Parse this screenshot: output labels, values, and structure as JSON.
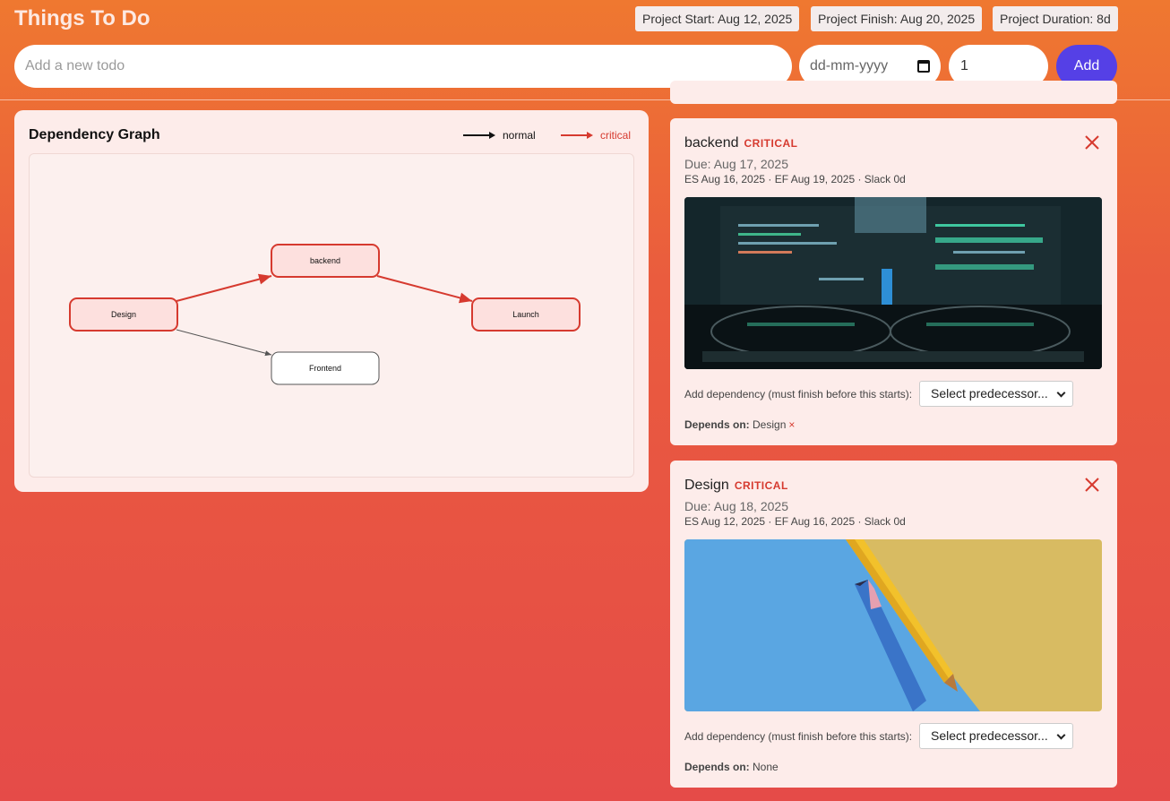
{
  "header": {
    "title": "Things To Do",
    "project_start": "Project Start: Aug 12, 2025",
    "project_finish": "Project Finish: Aug 20, 2025",
    "project_duration": "Project Duration: 8d"
  },
  "form": {
    "todo_placeholder": "Add a new todo",
    "date_placeholder": "dd-mm-yyyy",
    "duration_value": "1",
    "add_label": "Add"
  },
  "graph": {
    "title": "Dependency Graph",
    "legend_normal": "normal",
    "legend_critical": "critical",
    "nodes": [
      {
        "id": "design",
        "label": "Design",
        "critical": true
      },
      {
        "id": "backend",
        "label": "backend",
        "critical": true
      },
      {
        "id": "frontend",
        "label": "Frontend",
        "critical": false
      },
      {
        "id": "launch",
        "label": "Launch",
        "critical": true
      }
    ],
    "edges": [
      {
        "from": "design",
        "to": "backend",
        "critical": true
      },
      {
        "from": "backend",
        "to": "launch",
        "critical": true
      },
      {
        "from": "design",
        "to": "frontend",
        "critical": false
      }
    ]
  },
  "cards": [
    {
      "title": "backend",
      "badge": "CRITICAL",
      "due": "Due: Aug 17, 2025",
      "schedule": "ES Aug 16, 2025 · EF Aug 19, 2025 · Slack 0d",
      "dep_label": "Add dependency (must finish before this starts):",
      "select_label": "Select predecessor...",
      "depends_label": "Depends on:",
      "depends_value": "Design",
      "remove_symbol": "×"
    },
    {
      "title": "Design",
      "badge": "CRITICAL",
      "due": "Due: Aug 18, 2025",
      "schedule": "ES Aug 12, 2025 · EF Aug 16, 2025 · Slack 0d",
      "dep_label": "Add dependency (must finish before this starts):",
      "select_label": "Select predecessor...",
      "depends_label": "Depends on:",
      "depends_value": "None"
    }
  ],
  "colors": {
    "critical": "#d63a2f",
    "accent": "#5540e6",
    "normal_edge": "#555555"
  }
}
